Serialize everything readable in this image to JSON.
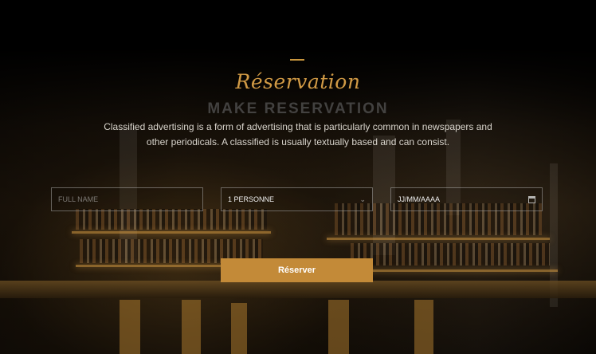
{
  "header": {
    "script_title": "Réservation",
    "ghost_title": "MAKE RESERVATION",
    "description": "Classified advertising is a form of advertising that is particularly common in newspapers and other periodicals. A classified is usually textually based and can consist."
  },
  "form": {
    "name_placeholder": "FULL NAME",
    "persons_value": "1 PERSONNE",
    "date_value": "JJ/MM/AAAA",
    "submit_label": "Réserver"
  },
  "colors": {
    "accent": "#c38a38",
    "title_gold": "#d19a45"
  },
  "icons": {
    "persons_dropdown": "chevron-down-icon",
    "date_picker": "calendar-icon"
  }
}
